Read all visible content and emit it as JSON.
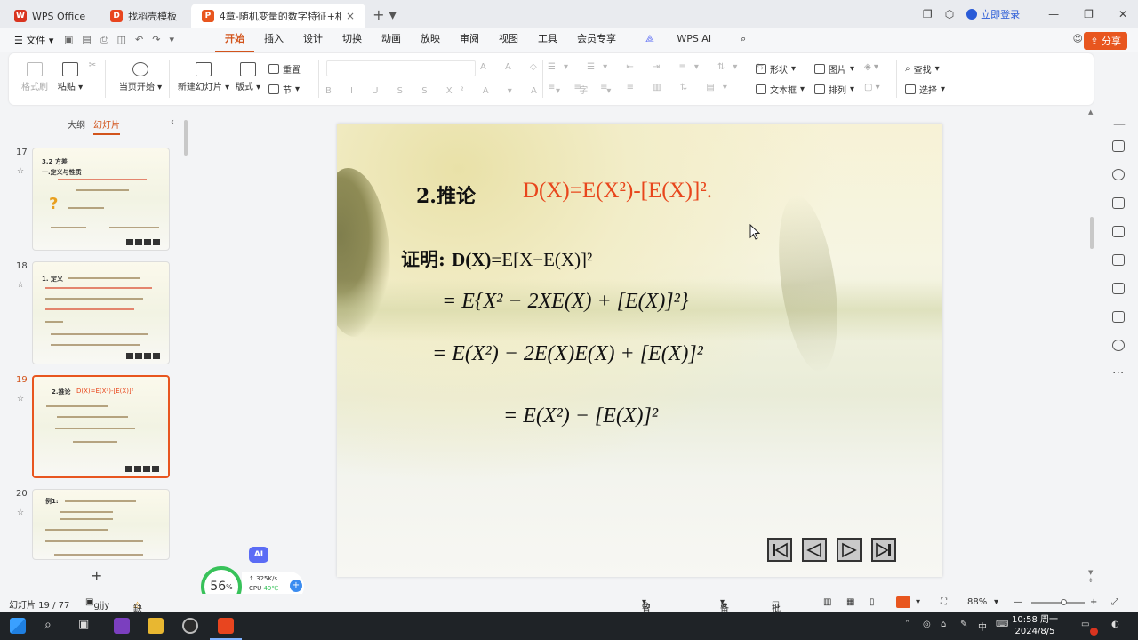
{
  "tabs": [
    {
      "label": "WPS Office",
      "logo": "W",
      "logo_color": "#d9341f"
    },
    {
      "label": "找稻壳模板",
      "logo": "D",
      "logo_color": "#e8451f"
    },
    {
      "label": "4章-随机变量的数字特征+相…",
      "logo": "P",
      "logo_color": "#e8561f"
    }
  ],
  "titlebar": {
    "login": "立即登录"
  },
  "menu": {
    "file": "文件",
    "items": [
      "开始",
      "插入",
      "设计",
      "切换",
      "动画",
      "放映",
      "审阅",
      "视图",
      "工具",
      "会员专享"
    ],
    "active": "开始",
    "wps_ai": "WPS AI",
    "share": "分享"
  },
  "ribbon": {
    "format_painter": "格式刷",
    "paste": "粘贴",
    "play_from_current": "当页开始",
    "new_slide": "新建幻灯片",
    "layout": "版式",
    "reset": "重置",
    "section": "节",
    "shape": "形状",
    "picture": "图片",
    "textbox": "文本框",
    "arrange": "排列",
    "find": "查找",
    "select": "选择"
  },
  "leftpanel": {
    "tab_outline": "大纲",
    "tab_slides": "幻灯片",
    "thumbnails": [
      {
        "num": "17",
        "title": "3.2 方差",
        "subtitle": "一.定义与性质"
      },
      {
        "num": "18",
        "title": "1. 定义",
        "subtitle": ""
      },
      {
        "num": "19",
        "title": "2.推论",
        "subtitle": "D(X)=E(X²)-[E(X)]²"
      },
      {
        "num": "20",
        "title": "例1:",
        "subtitle": ""
      }
    ],
    "active_num": "19"
  },
  "slide": {
    "heading": "2.推论",
    "formula": "D(X)=E(X²)-[E(X)]².",
    "proof_label": "证明: ",
    "proof_dx": "D(X)",
    "proof_rest": "=E[X−E(X)]²",
    "line1": "= E{X² − 2XE(X) + [E(X)]²}",
    "line2": "= E(X²) − 2E(X)E(X) + [E(X)]²",
    "line3": "= E(X²) − [E(X)]²"
  },
  "perf": {
    "percent": "56",
    "percent_unit": "%",
    "net": "325K/s",
    "cpu_label": "CPU",
    "cpu_temp": "49℃",
    "ai": "AI"
  },
  "status": {
    "slide_pos": "幻灯片 19 / 77",
    "theme": "gjjy",
    "missing_font": "缺失字体",
    "beautify": "智能美化",
    "notes": "备注",
    "comments": "批注",
    "zoom": "88%"
  },
  "taskbar": {
    "time": "10:58 周一",
    "date": "2024/8/5",
    "ime": "中"
  }
}
